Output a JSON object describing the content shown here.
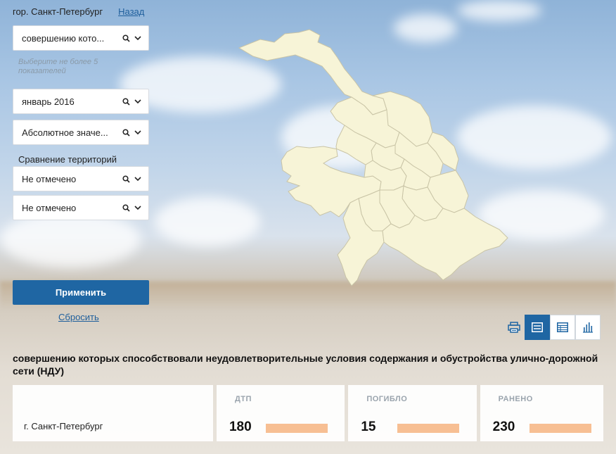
{
  "region": {
    "name": "гор. Санкт-Петербург",
    "back_label": "Назад"
  },
  "filters": {
    "indicator": {
      "value": "совершению кото..."
    },
    "hint": "Выберите не более 5 показателей",
    "period": {
      "value": "январь 2016"
    },
    "value_type": {
      "value": "Абсолютное значе..."
    },
    "comparison_label": "Сравнение территорий",
    "compare1": {
      "value": "Не отмечено"
    },
    "compare2": {
      "value": "Не отмечено"
    },
    "apply_label": "Применить",
    "reset_label": "Сбросить"
  },
  "toolbar": {
    "icons": [
      "print-icon",
      "list-view-icon",
      "table-view-icon",
      "chart-view-icon"
    ],
    "active": "list-view-icon"
  },
  "report": {
    "title": "совершению которых способствовали неудовлетворительные условия содержания и обустройства улично-дорожной сети (НДУ)",
    "row": {
      "territory": "г. Санкт-Петербург",
      "metrics": [
        {
          "header": "ДТП",
          "value": "180"
        },
        {
          "header": "ПОГИБЛО",
          "value": "15"
        },
        {
          "header": "РАНЕНО",
          "value": "230"
        }
      ]
    }
  },
  "colors": {
    "accent": "#1f66a3",
    "bar": "#f7bf93",
    "map_fill": "#f7f4d7",
    "map_stroke": "#c9c4a6"
  }
}
